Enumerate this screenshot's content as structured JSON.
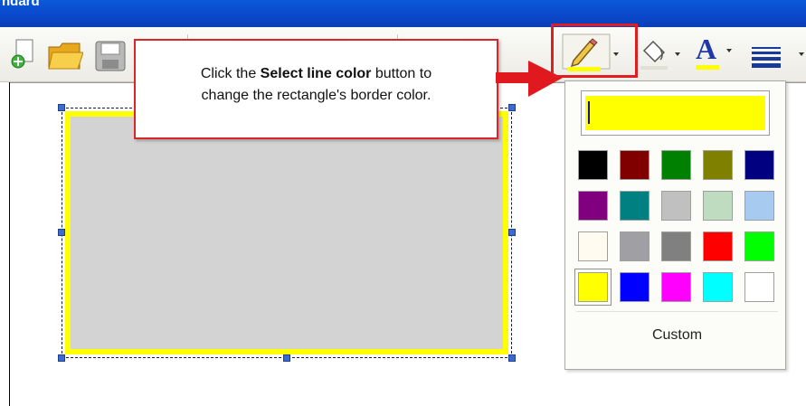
{
  "window": {
    "title": "ndard"
  },
  "callout": {
    "pre": "Click the ",
    "bold": "Select line color",
    "post": " button to",
    "line2": "change the rectangle's border color."
  },
  "toolbar": {
    "buttons": [
      {
        "name": "new-document-icon"
      },
      {
        "name": "open-folder-icon"
      },
      {
        "name": "save-disk-icon"
      },
      {
        "name": "select-line-color-button"
      },
      {
        "name": "fill-color-button"
      },
      {
        "name": "font-color-button"
      },
      {
        "name": "line-style-button"
      }
    ],
    "font_color_glyph": "A"
  },
  "palette": {
    "current_color": "#ffff00",
    "colors": [
      [
        "#000000",
        "#800000",
        "#008000",
        "#808000",
        "#000080"
      ],
      [
        "#800080",
        "#008080",
        "#c0c0c0",
        "#c0dcc0",
        "#a6caf0"
      ],
      [
        "#fffbf0",
        "#a0a0a4",
        "#808080",
        "#ff0000",
        "#00ff00"
      ],
      [
        "#ffff00",
        "#0000ff",
        "#ff00ff",
        "#00ffff",
        "#ffffff"
      ]
    ],
    "selected": "#ffff00",
    "custom_label": "Custom"
  },
  "shape": {
    "fill": "#d3d3d3",
    "border_color": "#ffff00"
  }
}
